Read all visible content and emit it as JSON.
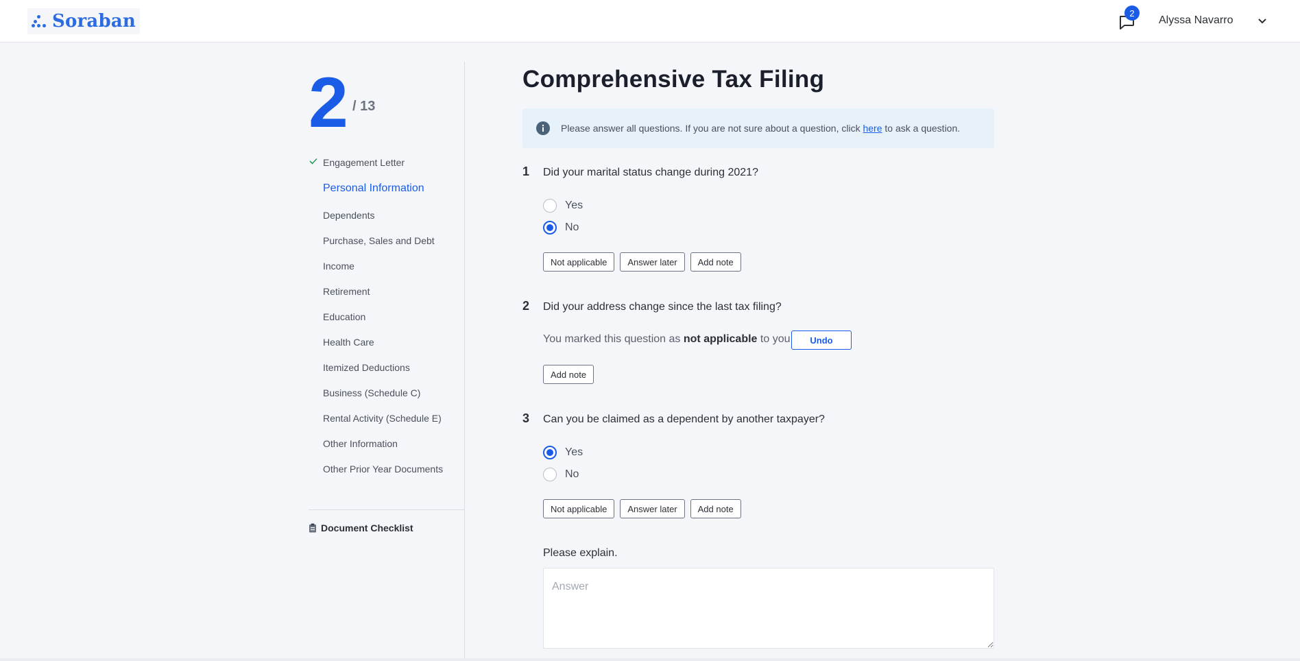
{
  "brand": {
    "name": "Soraban",
    "color": "#2d6cdf"
  },
  "header": {
    "messages_icon": "chat-bubble-icon",
    "unread_count": "2",
    "user_name": "Alyssa Navarro",
    "user_menu_icon": "chevron-down-icon"
  },
  "progress": {
    "current": "2",
    "total": "/ 13"
  },
  "sidebar": {
    "items": [
      {
        "label": "Engagement Letter",
        "state": "completed"
      },
      {
        "label": "Personal Information",
        "state": "active"
      },
      {
        "label": "Dependents",
        "state": "pending"
      },
      {
        "label": "Purchase, Sales and Debt",
        "state": "pending"
      },
      {
        "label": "Income",
        "state": "pending"
      },
      {
        "label": "Retirement",
        "state": "pending"
      },
      {
        "label": "Education",
        "state": "pending"
      },
      {
        "label": "Health Care",
        "state": "pending"
      },
      {
        "label": "Itemized Deductions",
        "state": "pending"
      },
      {
        "label": "Business (Schedule C)",
        "state": "pending"
      },
      {
        "label": "Rental Activity (Schedule E)",
        "state": "pending"
      },
      {
        "label": "Other Information",
        "state": "pending"
      },
      {
        "label": "Other Prior Year Documents",
        "state": "pending"
      }
    ],
    "document_checklist": "Document Checklist"
  },
  "main": {
    "title": "Comprehensive Tax Filing",
    "info": {
      "before": "Please answer all questions. If you are not sure about a question, click",
      "link": "here",
      "after": "to ask a question."
    },
    "questions": [
      {
        "number": "1",
        "text": "Did your marital status change during 2021?",
        "options": [
          "Yes",
          "No"
        ],
        "selected": "No",
        "actions": [
          "Not applicable",
          "Answer later",
          "Add note"
        ]
      },
      {
        "number": "2",
        "text": "Did your address change since the last tax filing?",
        "na_prefix": "You marked this question as",
        "na_bold": "not applicable",
        "na_suffix": "to you.",
        "undo": "Undo",
        "actions": [
          "Add note"
        ]
      },
      {
        "number": "3",
        "text": "Can you be claimed as a dependent by another taxpayer?",
        "options": [
          "Yes",
          "No"
        ],
        "selected": "Yes",
        "actions": [
          "Not applicable",
          "Answer later",
          "Add note"
        ],
        "followup_label": "Please explain.",
        "answer_placeholder": "Answer",
        "answer_value": ""
      }
    ]
  },
  "colors": {
    "accent": "#1a5ce6",
    "info_bg": "#e6f1fa",
    "page_bg": "#f4f6f9"
  }
}
